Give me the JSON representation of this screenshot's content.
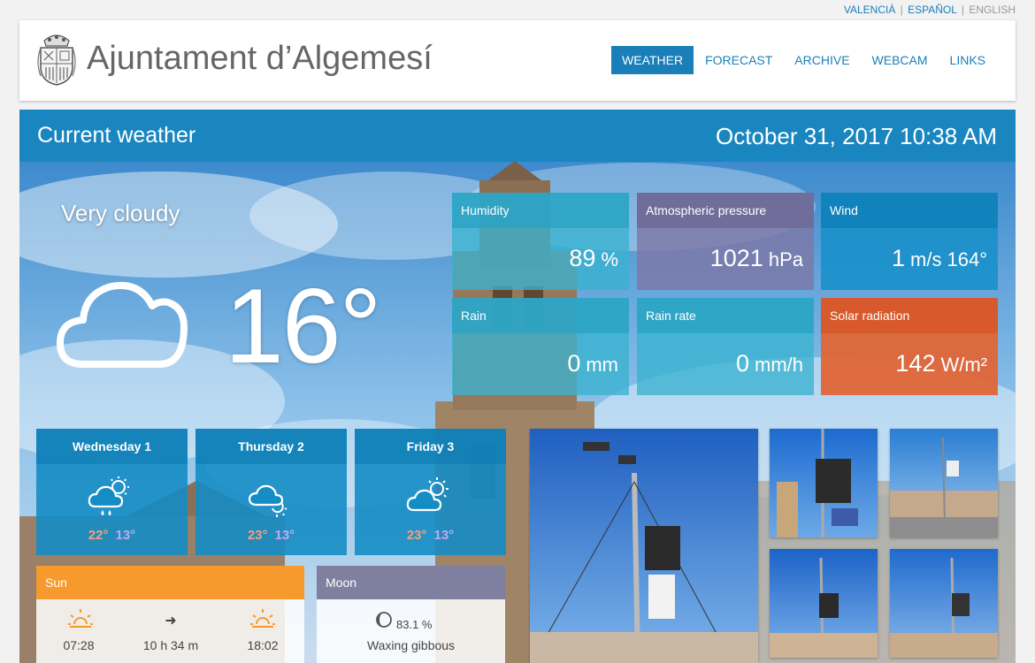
{
  "lang": {
    "valencia": "VALENCIÀ",
    "espanol": "ESPAÑOL",
    "english": "ENGLISH",
    "sep": "|"
  },
  "site": {
    "title": "Ajuntament d’Algemesí"
  },
  "nav": {
    "weather": "WEATHER",
    "forecast": "FORECAST",
    "archive": "ARCHIVE",
    "webcam": "WEBCAM",
    "links": "LINKS"
  },
  "current": {
    "heading": "Current weather",
    "datetime": "October 31, 2017 10:38 AM",
    "condition": "Very cloudy",
    "temperature": "16°",
    "icon": "cloud-icon"
  },
  "metrics": {
    "humidity": {
      "label": "Humidity",
      "value": "89",
      "unit": "%"
    },
    "pressure": {
      "label": "Atmospheric pressure",
      "value": "1021",
      "unit": "hPa"
    },
    "wind": {
      "label": "Wind",
      "value": "1",
      "unit": "m/s",
      "direction": "164°"
    },
    "rain": {
      "label": "Rain",
      "value": "0",
      "unit": "mm"
    },
    "rain_rate": {
      "label": "Rain rate",
      "value": "0",
      "unit": "mm/h"
    },
    "solar": {
      "label": "Solar radiation",
      "value": "142",
      "unit": "W/m²"
    }
  },
  "forecast": [
    {
      "day": "Wednesday 1",
      "high": "22°",
      "low": "13°",
      "icon": "sun-cloud-rain-icon"
    },
    {
      "day": "Thursday 2",
      "high": "23°",
      "low": "13°",
      "icon": "cloud-sun-icon"
    },
    {
      "day": "Friday 3",
      "high": "23°",
      "low": "13°",
      "icon": "sun-cloud-icon"
    }
  ],
  "sun": {
    "label": "Sun",
    "sunrise": "07:28",
    "daylight": "10 h 34 m",
    "sunset": "18:02"
  },
  "moon": {
    "label": "Moon",
    "illumination": "83.1 %",
    "phase": "Waxing gibbous"
  },
  "colors": {
    "accent": "#1a7fb8",
    "header_bar": "#1a86c0",
    "sun_bar": "#f79a2e",
    "moon_bar": "#7f7fa0",
    "solar_tile": "#e2643a"
  }
}
